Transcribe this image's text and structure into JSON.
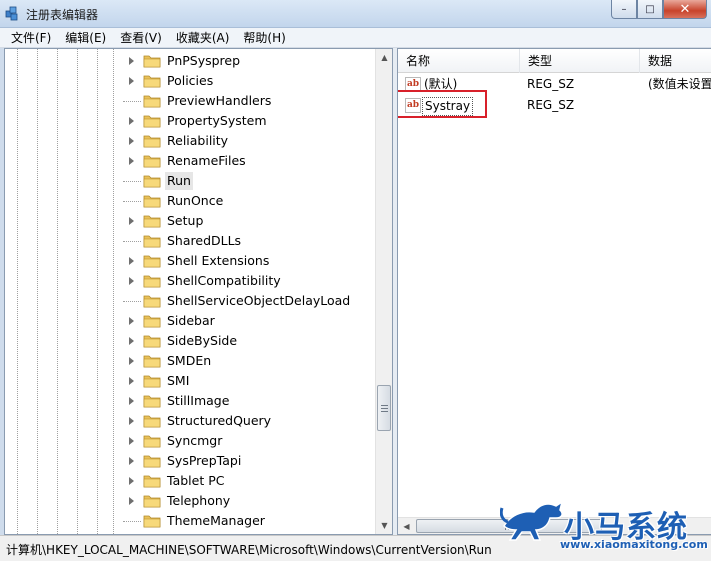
{
  "window": {
    "title": "注册表编辑器",
    "icon": "registry-editor-icon",
    "controls": {
      "minimize": "–",
      "maximize": "□",
      "close": "✕"
    }
  },
  "menu": [
    "文件(F)",
    "编辑(E)",
    "查看(V)",
    "收藏夹(A)",
    "帮助(H)"
  ],
  "tree": {
    "selected": "Run",
    "items": [
      {
        "label": "PnPSysprep",
        "expandable": true
      },
      {
        "label": "Policies",
        "expandable": true
      },
      {
        "label": "PreviewHandlers",
        "expandable": false
      },
      {
        "label": "PropertySystem",
        "expandable": true
      },
      {
        "label": "Reliability",
        "expandable": true
      },
      {
        "label": "RenameFiles",
        "expandable": true
      },
      {
        "label": "Run",
        "expandable": false
      },
      {
        "label": "RunOnce",
        "expandable": false
      },
      {
        "label": "Setup",
        "expandable": true
      },
      {
        "label": "SharedDLLs",
        "expandable": false
      },
      {
        "label": "Shell Extensions",
        "expandable": true
      },
      {
        "label": "ShellCompatibility",
        "expandable": true
      },
      {
        "label": "ShellServiceObjectDelayLoad",
        "expandable": false
      },
      {
        "label": "Sidebar",
        "expandable": true
      },
      {
        "label": "SideBySide",
        "expandable": true
      },
      {
        "label": "SMDEn",
        "expandable": true
      },
      {
        "label": "SMI",
        "expandable": true
      },
      {
        "label": "StillImage",
        "expandable": true
      },
      {
        "label": "StructuredQuery",
        "expandable": true
      },
      {
        "label": "Syncmgr",
        "expandable": true
      },
      {
        "label": "SysPrepTapi",
        "expandable": true
      },
      {
        "label": "Tablet PC",
        "expandable": true
      },
      {
        "label": "Telephony",
        "expandable": true
      },
      {
        "label": "ThemeManager",
        "expandable": false
      }
    ]
  },
  "list": {
    "columns": [
      "名称",
      "类型",
      "数据"
    ],
    "rows": [
      {
        "name": "(默认)",
        "type": "REG_SZ",
        "data": "(数值未设置"
      },
      {
        "name": "Systray",
        "type": "REG_SZ",
        "data": ""
      }
    ]
  },
  "status": "计算机\\HKEY_LOCAL_MACHINE\\SOFTWARE\\Microsoft\\Windows\\CurrentVersion\\Run",
  "watermark": {
    "brand": "小马系统",
    "url": "www.xiaomaxitong.com"
  },
  "colors": {
    "highlight_box": "#d8202a",
    "brand_blue": "#1e5fb4"
  }
}
